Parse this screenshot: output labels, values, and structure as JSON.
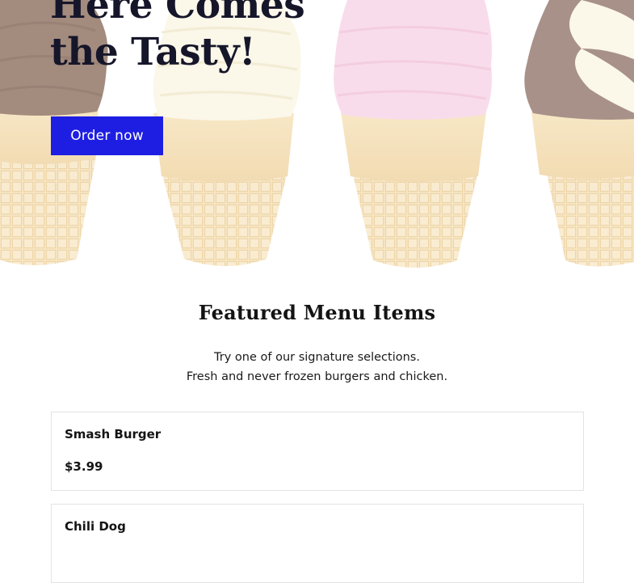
{
  "hero": {
    "title_line1": "Here Comes",
    "title_line2": "the Tasty!",
    "cta_label": "Order now"
  },
  "featured": {
    "title": "Featured Menu Items",
    "subtitle_line1": "Try one of our signature selections.",
    "subtitle_line2": "Fresh and never frozen burgers and chicken."
  },
  "menu_items": [
    {
      "name": "Smash Burger",
      "price": "$3.99"
    },
    {
      "name": "Chili Dog",
      "price": ""
    }
  ],
  "colors": {
    "accent": "#1e1ee3",
    "heading": "#16162a"
  },
  "icons": {
    "hero_background": "ice-cream-cones-illustration"
  }
}
